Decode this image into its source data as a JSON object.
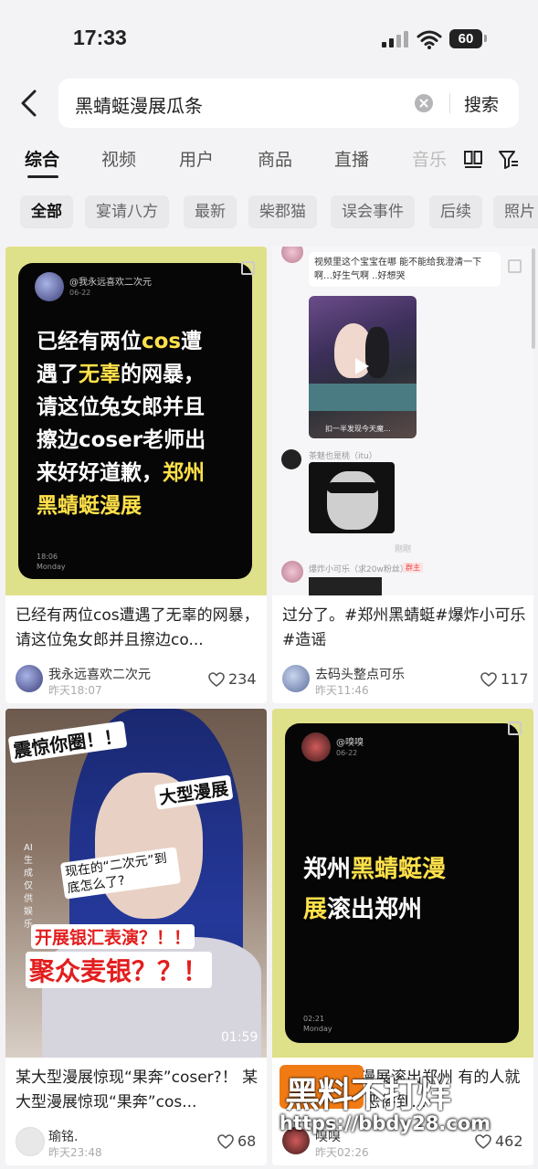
{
  "status": {
    "time": "17:33",
    "battery": "60"
  },
  "search": {
    "query": "黑蜻蜓漫展瓜条",
    "button": "搜索"
  },
  "tabs": [
    "综合",
    "视频",
    "用户",
    "商品",
    "直播",
    "音乐"
  ],
  "chips": [
    "全部",
    "宴请八方",
    "最新",
    "柴郡猫",
    "误会事件",
    "后续",
    "照片"
  ],
  "cards": [
    {
      "cover_user": "@我永远喜欢二次元",
      "cover_date": "06-22",
      "cover_lines": [
        "已经有两位cos遭",
        "遇了无辜的网暴，",
        "请这位兔女郎并且",
        "擦边coser老师出",
        "来好好道歉，郑州",
        "黑蜻蜓漫展"
      ],
      "cover_time": "18:06",
      "cover_day": "Monday",
      "caption": "已经有两位cos遭遇了无辜的网暴，请这位兔女郎并且擦边co...",
      "author": "我永远喜欢二次元",
      "time": "昨天18:07",
      "likes": "234"
    },
    {
      "chat_msg": "视频里这个宝宝在哪 能不能给我澄清一下啊…好生气啊 ..好想哭",
      "video_caption": "扣一半发现今天魔...",
      "chat_name1": "茶魅也是桃（itu）",
      "chat_small": "刚刚",
      "chat_name2": "爆炸小可乐（求20w粉丝）",
      "chat_badge": "群主",
      "caption": "过分了。#郑州黑蜻蜓#爆炸小可乐 #造谣",
      "author": "去码头整点可乐",
      "time": "昨天11:46",
      "likes": "117"
    },
    {
      "stickers": [
        "震惊你圈！！",
        "大型漫展",
        "现在的“二次元”到底怎么了?",
        "开展银汇表演？！！",
        "聚众麦银？？！"
      ],
      "side_label": "AI生成 仅供娱乐",
      "duration": "01:59",
      "caption": "某大型漫展惊现“果奔”coser?！ 某大型漫展惊现“果奔”cos...",
      "author": "瑜铭.",
      "time": "昨天23:48",
      "likes": "68"
    },
    {
      "cover_user": "@嗅嗅",
      "cover_date": "06-22",
      "cover_lines": [
        "郑州黑蜻蜓漫",
        "展滚出郑州"
      ],
      "cover_time": "02:21",
      "cover_day": "Monday",
      "caption": "郑州黑蜻蜓漫展滚出郑州 有的人就应该滚出去 恶俗到...",
      "author": "嗅嗅",
      "time": "昨天02:26",
      "likes": "462"
    }
  ],
  "watermark": {
    "brand": "黑料不打烊",
    "url": "https://bbdy28.com"
  }
}
